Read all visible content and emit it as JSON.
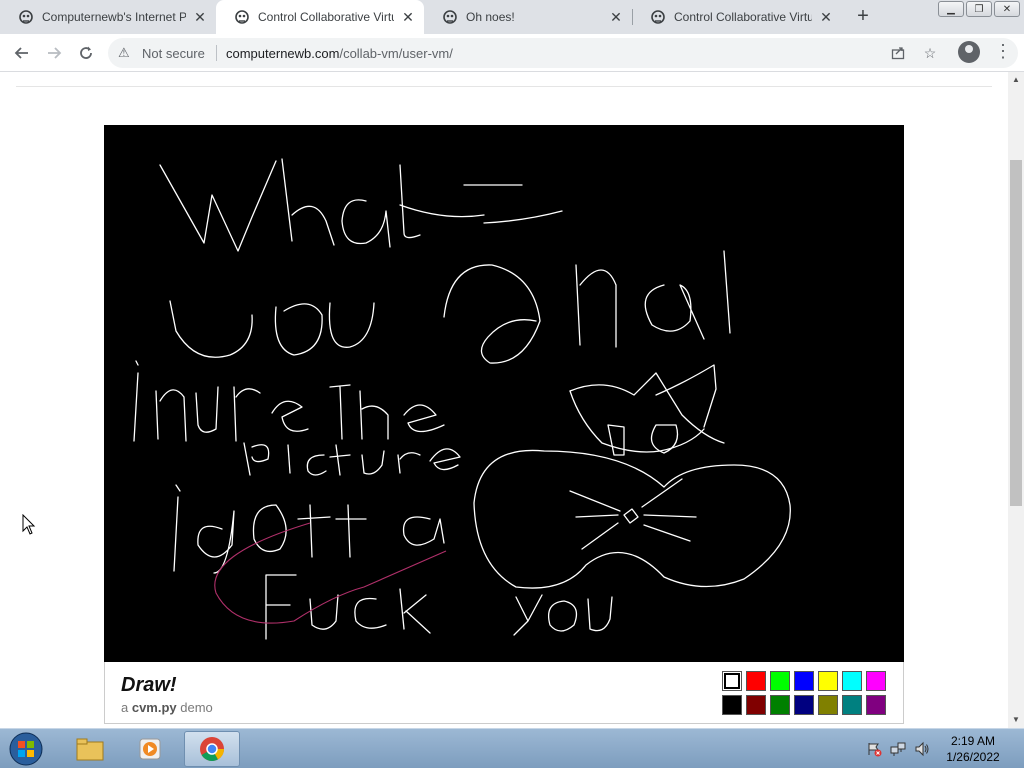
{
  "browser": {
    "tabs": [
      {
        "title": "Computernewb's Internet P",
        "active": false
      },
      {
        "title": "Control Collaborative Virtu",
        "active": true
      },
      {
        "title": "Oh noes!",
        "active": false
      },
      {
        "title": "Control Collaborative Virtu",
        "active": false
      }
    ],
    "new_tab_label": "+",
    "security_label": "Not secure",
    "url_host": "computernewb.com",
    "url_path": "/collab-vm/user-vm/"
  },
  "canvas_app": {
    "title": "Draw!",
    "subtitle_prefix": "a ",
    "subtitle_bold": "cvm.py",
    "subtitle_suffix": " demo",
    "palette": [
      "#ffffff",
      "#ff0000",
      "#00ff00",
      "#0000ff",
      "#ffff00",
      "#00ffff",
      "#ff00ff",
      "#000000",
      "#800000",
      "#008000",
      "#000080",
      "#808000",
      "#008080",
      "#800080"
    ],
    "selected_color": "#ffffff",
    "background_color": "#000000",
    "stroke_colors": {
      "main": "#ffffff",
      "accent": "#b0306a"
    }
  },
  "taskbar": {
    "time": "2:19 AM",
    "date": "1/26/2022"
  },
  "icons": {
    "tab_favicon": "collabvm-favicon",
    "back": "back-arrow-icon",
    "forward": "forward-arrow-icon",
    "reload": "reload-icon",
    "warning": "warning-icon",
    "share": "share-icon",
    "star": "bookmark-star-icon",
    "profile": "profile-icon",
    "menu": "menu-dots-icon"
  }
}
